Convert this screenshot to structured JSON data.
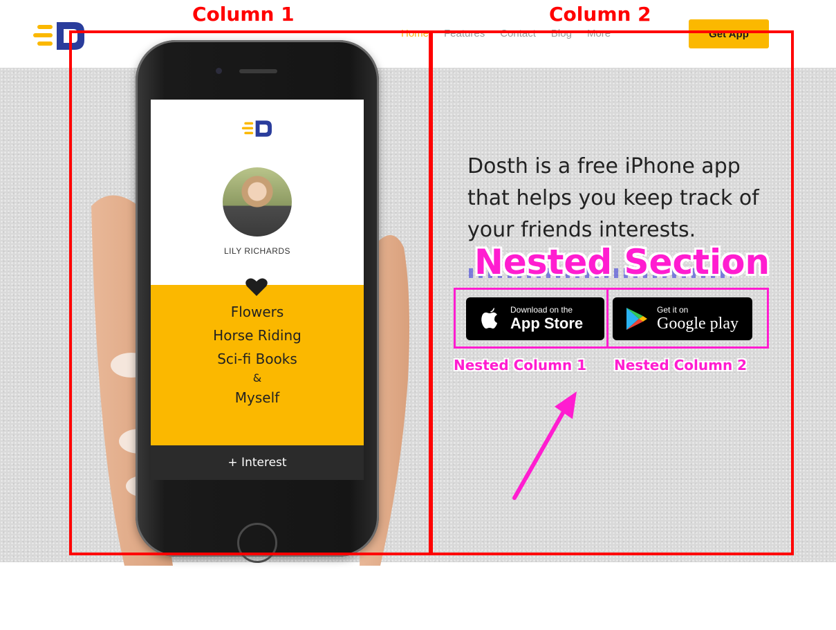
{
  "header": {
    "nav": [
      "Home",
      "Features",
      "Contact",
      "Blog",
      "More"
    ],
    "cta": "Get App"
  },
  "phone": {
    "profile_name": "LILY RICHARDS",
    "interests": [
      "Flowers",
      "Horse Riding",
      "Sci-fi Books"
    ],
    "ampersand": "&",
    "last_interest": "Myself",
    "add_button": "+ Interest"
  },
  "hero": {
    "tagline_lines": [
      "Dosth is a free iPhone app",
      "that helps you keep track of",
      "your friends interests."
    ],
    "app_store": {
      "small": "Download on the",
      "big": "App Store"
    },
    "google_play": {
      "small": "Get it on",
      "big": "Google play"
    }
  },
  "annotations": {
    "column1": "Column 1",
    "column2": "Column 2",
    "nested_section": "Nested Section",
    "nested_col1": "Nested Column 1",
    "nested_col2": "Nested Column 2"
  },
  "colors": {
    "accent": "#fbb800",
    "brand_blue": "#2a3d9c",
    "annotation_red": "#ff0000",
    "annotation_magenta": "#ff1dd0"
  }
}
